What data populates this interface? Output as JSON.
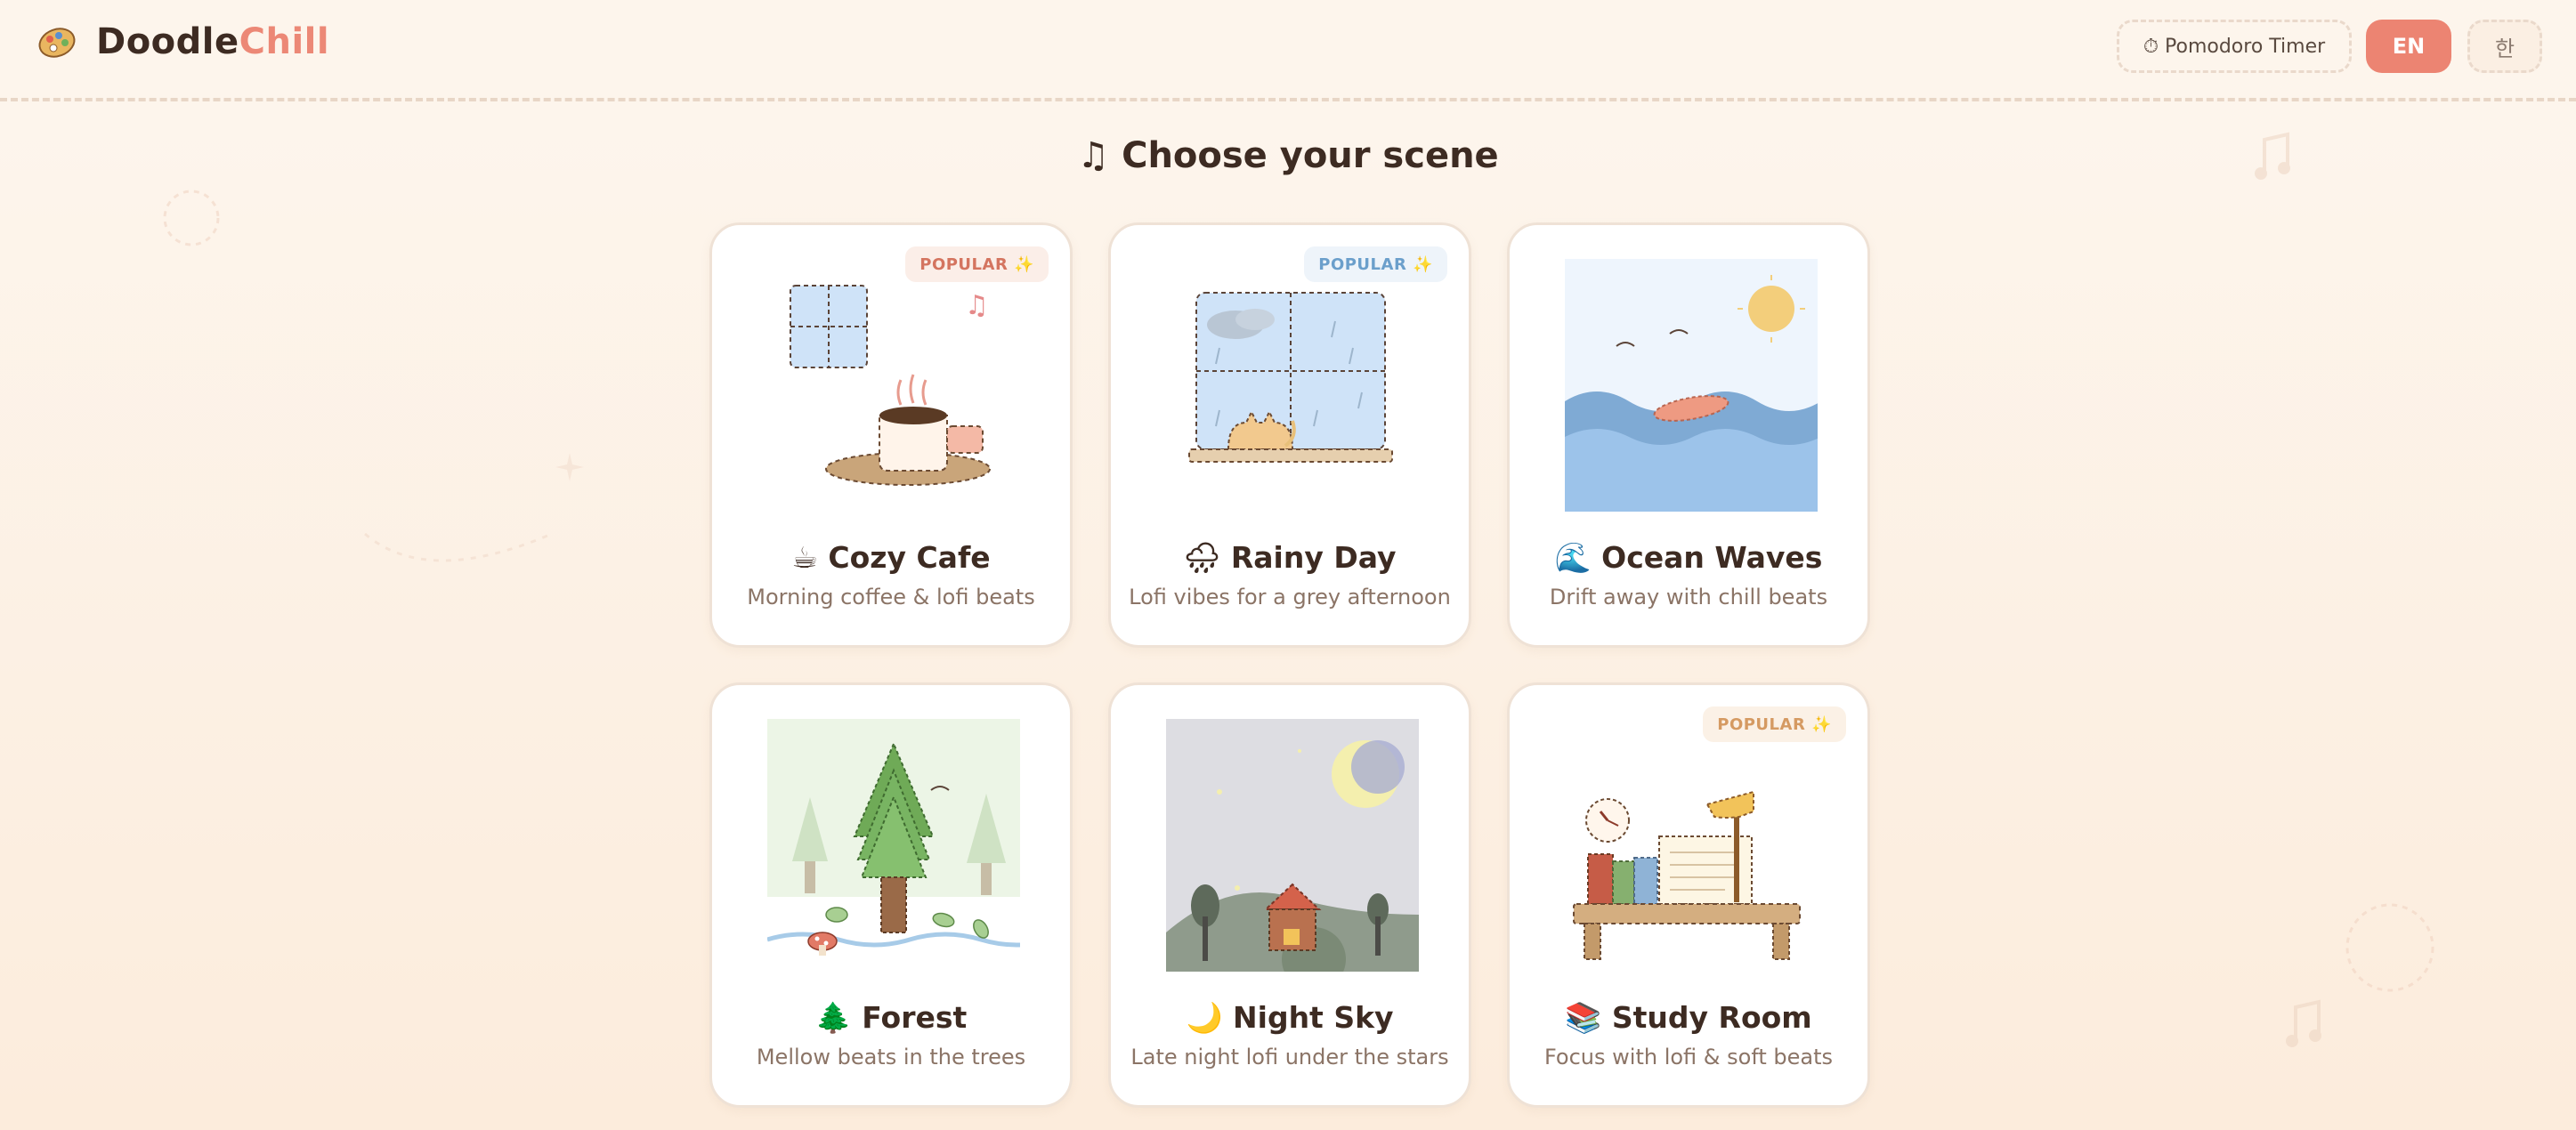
{
  "header": {
    "logo_part1": "Doodle",
    "logo_part2": "Chill",
    "pomodoro_label": "⏱ Pomodoro Timer",
    "lang_en": "EN",
    "lang_ko": "한"
  },
  "main": {
    "title": "♫ Choose your scene"
  },
  "scenes": [
    {
      "emoji_title": "☕ Cozy Cafe",
      "desc": "Morning coffee & lofi beats",
      "badge": "POPULAR ✨"
    },
    {
      "emoji_title": "🌧 Rainy Day",
      "desc": "Lofi vibes for a grey afternoon",
      "badge": "POPULAR ✨"
    },
    {
      "emoji_title": "🌊 Ocean Waves",
      "desc": "Drift away with chill beats"
    },
    {
      "emoji_title": "🌲 Forest",
      "desc": "Mellow beats in the trees"
    },
    {
      "emoji_title": "🌙 Night Sky",
      "desc": "Late night lofi under the stars"
    },
    {
      "emoji_title": "📚 Study Room",
      "desc": "Focus with lofi & soft beats",
      "badge": "POPULAR ✨"
    }
  ],
  "colors": {
    "accent": "#ec8472",
    "background": "#fdf5ec",
    "text": "#3d2b22",
    "muted": "#8b7466"
  }
}
